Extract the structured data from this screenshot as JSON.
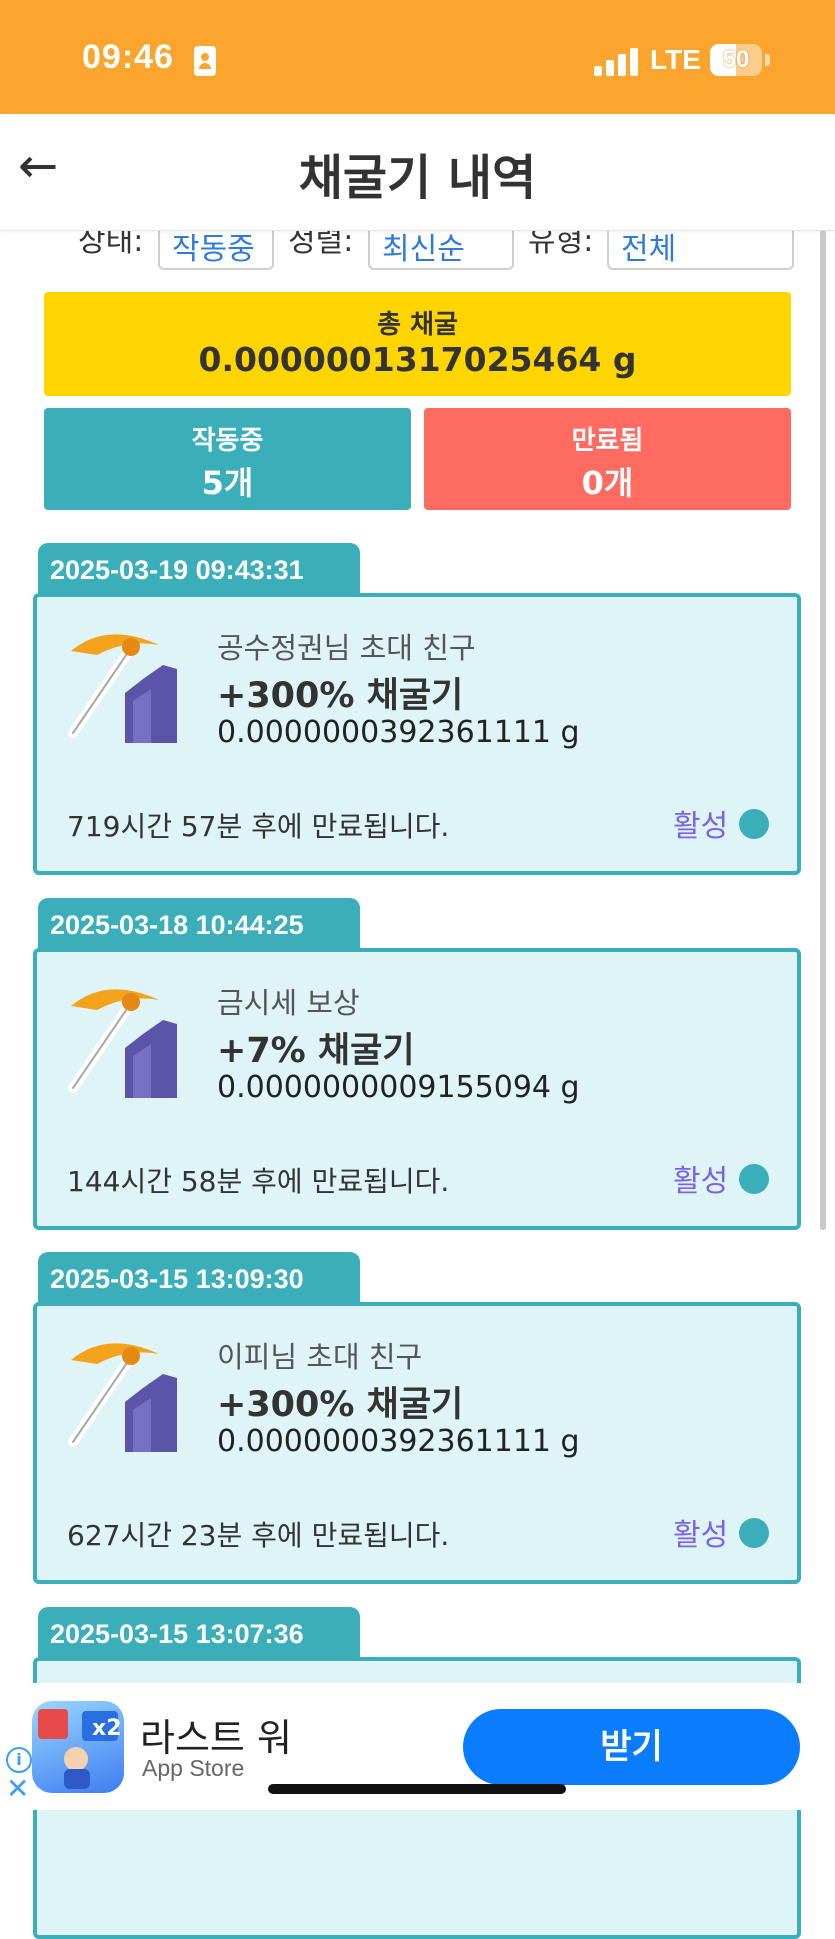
{
  "status_bar": {
    "time": "09:46",
    "network": "LTE",
    "battery": "50"
  },
  "header": {
    "title": "채굴기 내역"
  },
  "filters": {
    "status_label": "상태:",
    "status_value": "작동중",
    "sort_label": "정렬:",
    "sort_value": "최신순",
    "type_label": "유형:",
    "type_value": "전체"
  },
  "summary": {
    "total_label": "총 채굴",
    "total_value": "0.0000001317025464 g",
    "active_label": "작동중",
    "active_value": "5개",
    "expired_label": "만료됨",
    "expired_value": "0개"
  },
  "miners": [
    {
      "date": "2025-03-19 09:43:31",
      "source": "공수정권님 초대 친구",
      "type": "+300% 채굴기",
      "amount": "0.0000000392361111 g",
      "expire": "719시간 57분 후에 만료됩니다.",
      "status": "활성"
    },
    {
      "date": "2025-03-18 10:44:25",
      "source": "금시세 보상",
      "type": "+7% 채굴기",
      "amount": "0.0000000009155094 g",
      "expire": "144시간 58분 후에 만료됩니다.",
      "status": "활성"
    },
    {
      "date": "2025-03-15 13:09:30",
      "source": "이피님 초대 친구",
      "type": "+300% 채굴기",
      "amount": "0.0000000392361111 g",
      "expire": "627시간 23분 후에 만료됩니다.",
      "status": "활성"
    },
    {
      "date": "2025-03-15 13:07:36"
    }
  ],
  "ad": {
    "title": "라스트 워",
    "store": "App Store",
    "button": "받기",
    "icon_badge": "x2"
  },
  "colors": {
    "status_bar": "#fba52f",
    "teal": "#3aafb9",
    "yellow": "#ffd500",
    "red": "#ff6b61",
    "card_bg": "#def4f6",
    "active_text": "#7b63e6",
    "ad_button": "#0a7cff"
  }
}
